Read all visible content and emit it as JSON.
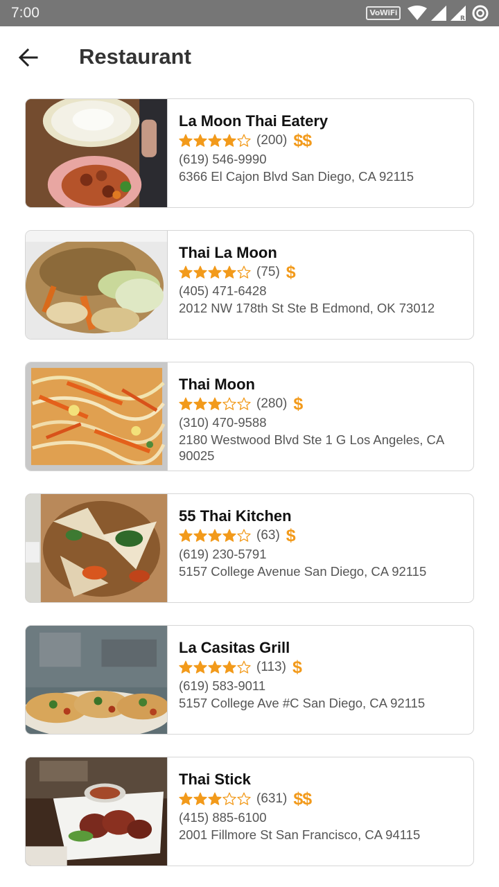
{
  "status_bar": {
    "time": "7:00",
    "wifi_badge": "VoWiFi",
    "icons": [
      "wifi-icon",
      "signal-icon",
      "signal-r-icon",
      "sync-icon"
    ]
  },
  "header": {
    "title": "Restaurant",
    "back_icon": "arrow-back-icon"
  },
  "colors": {
    "accent": "#f29a1b",
    "status_bar": "#767676",
    "card_border": "#d6d6d6"
  },
  "restaurants": [
    {
      "name": "La Moon Thai Eatery",
      "rating": 4,
      "reviews": "(200)",
      "price": "$$",
      "phone": "(619) 546-9990",
      "address": "6366 El Cajon Blvd San Diego, CA 92115",
      "image": "rice-and-orange-chicken-plate"
    },
    {
      "name": "Thai La Moon",
      "rating": 4,
      "reviews": "(75)",
      "price": "$",
      "phone": "(405) 471-6428",
      "address": "2012 NW 178th St Ste B Edmond, OK 73012",
      "image": "fried-rice-takeout"
    },
    {
      "name": "Thai Moon",
      "rating": 3,
      "reviews": "(280)",
      "price": "$",
      "phone": "(310) 470-9588",
      "address": "2180 Westwood Blvd Ste 1 G Los Angeles, CA 90025",
      "image": "pad-thai-foil"
    },
    {
      "name": "55 Thai Kitchen",
      "rating": 4,
      "reviews": "(63)",
      "price": "$",
      "phone": "(619) 230-5791",
      "address": "5157 College Avenue San Diego, CA 92115",
      "image": "wide-noodles-takeout-box"
    },
    {
      "name": "La Casitas Grill",
      "rating": 4,
      "reviews": "(113)",
      "price": "$",
      "phone": "(619) 583-9011",
      "address": "5157 College Ave #C San Diego, CA 92115",
      "image": "tacos-plate"
    },
    {
      "name": "Thai Stick",
      "rating": 3,
      "reviews": "(631)",
      "price": "$$",
      "phone": "(415) 885-6100",
      "address": "2001 Fillmore St San Francisco, CA 94115",
      "image": "grilled-meat-plate"
    }
  ]
}
